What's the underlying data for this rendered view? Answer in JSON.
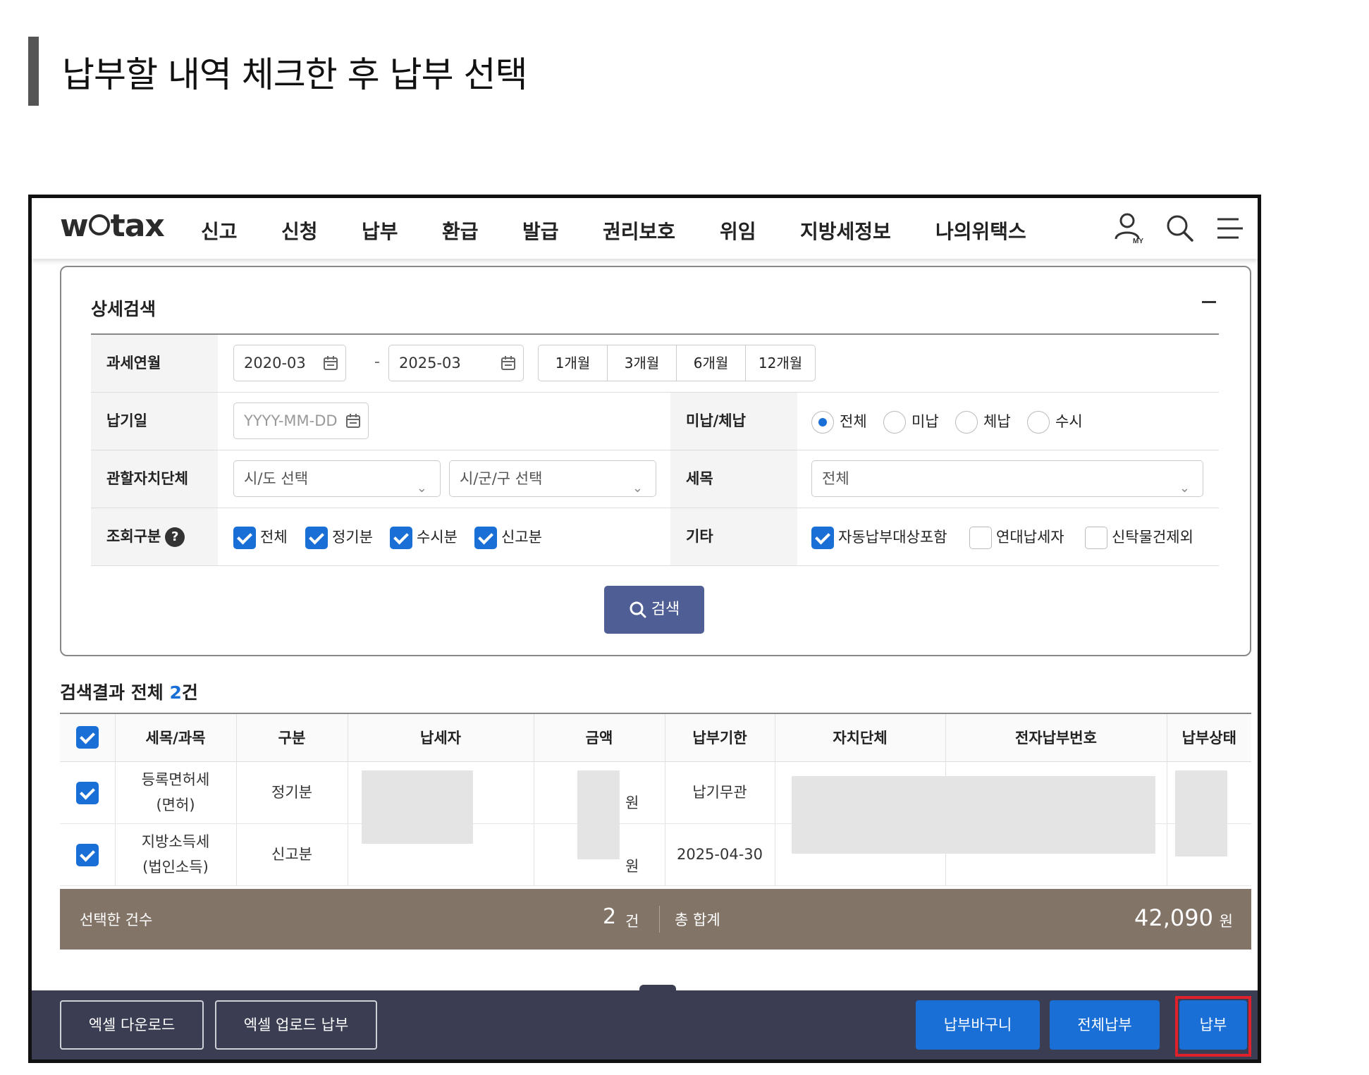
{
  "heading": "납부할 내역 체크한 후 납부 선택",
  "nav": {
    "logo": "wetax",
    "logo_parts": [
      "w",
      "tax"
    ],
    "menu": [
      "신고",
      "신청",
      "납부",
      "환급",
      "발급",
      "권리보호",
      "위임",
      "지방세정보",
      "나의위택스"
    ],
    "icons": [
      "my-user-icon",
      "search-icon",
      "hamburger-menu-icon"
    ]
  },
  "search": {
    "title": "상세검색",
    "tax_period": {
      "label": "과세연월",
      "from": "2020-03",
      "to": "2025-03",
      "presets": [
        "1개월",
        "3개월",
        "6개월",
        "12개월"
      ]
    },
    "due_date": {
      "label": "납기일",
      "placeholder": "YYYY-MM-DD"
    },
    "unpaid": {
      "label": "미납/체납",
      "options": [
        "전체",
        "미납",
        "체납",
        "수시"
      ],
      "selected": "전체"
    },
    "region": {
      "label": "관할자치단체",
      "sido": "시/도 선택",
      "sigungu": "시/군/구 선택"
    },
    "tax_item": {
      "label": "세목",
      "value": "전체"
    },
    "query_type": {
      "label": "조회구분",
      "options": [
        "전체",
        "정기분",
        "수시분",
        "신고분"
      ],
      "checked": [
        true,
        true,
        true,
        true
      ]
    },
    "etc": {
      "label": "기타",
      "options": [
        "자동납부대상포함",
        "연대납세자",
        "신탁물건제외"
      ],
      "checked": [
        true,
        false,
        false
      ]
    },
    "button": "검색"
  },
  "results": {
    "head_label": "검색결과 전체",
    "count": "2",
    "count_unit": "건",
    "columns": [
      "세목/과목",
      "구분",
      "납세자",
      "금액",
      "납부기한",
      "자치단체",
      "전자납부번호",
      "납부상태"
    ],
    "rows": [
      {
        "tax": "등록면허세",
        "sub": "(면허)",
        "type": "정기분",
        "won": "원",
        "due": "납기무관"
      },
      {
        "tax": "지방소득세",
        "sub": "(법인소득)",
        "type": "신고분",
        "won": "원",
        "due": "2025-04-30"
      }
    ]
  },
  "summary": {
    "selected_label": "선택한 건수",
    "selected_count": "2",
    "count_unit": "건",
    "total_label": "총 합계",
    "total_amount": "42,090",
    "currency": "원"
  },
  "actions": {
    "excel_download": "엑셀 다운로드",
    "excel_upload": "엑셀 업로드 납부",
    "cart": "납부바구니",
    "pay_all": "전체납부",
    "pay": "납부"
  },
  "colors": {
    "primary": "#1a6fd6",
    "summary_bar": "#837468",
    "bottom_bar": "#3b3e52",
    "search_button": "#4f5f95",
    "highlight": "#e0202a"
  }
}
